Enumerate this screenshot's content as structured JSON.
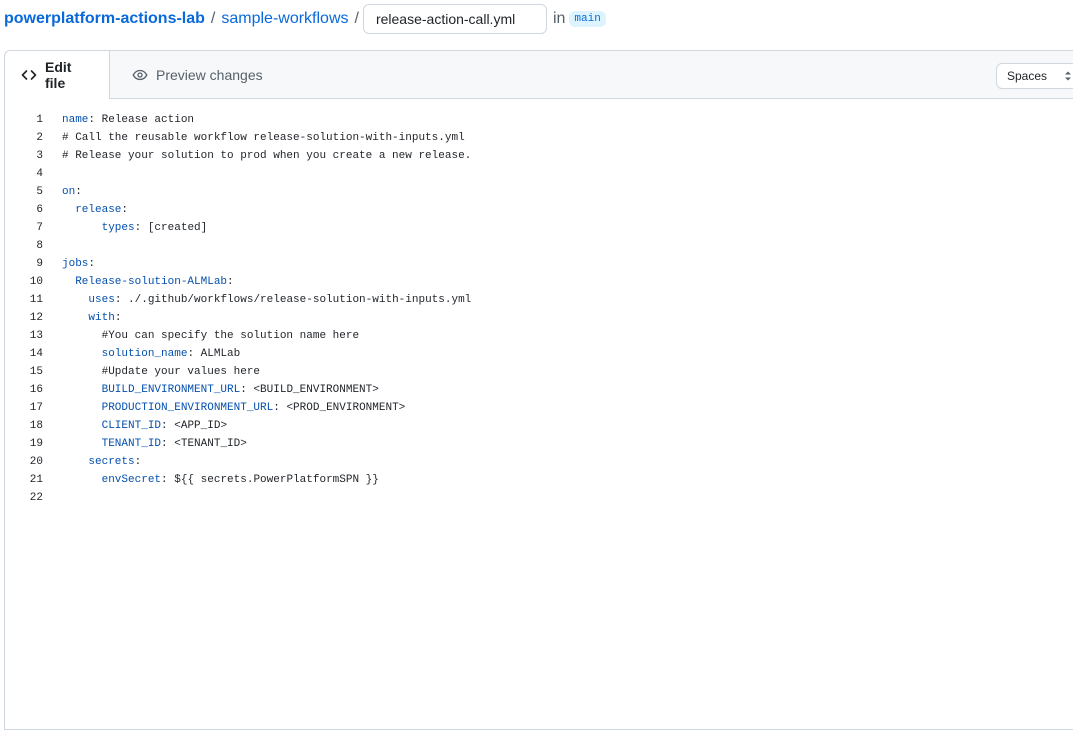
{
  "breadcrumb": {
    "repo": "powerplatform-actions-lab",
    "separator": "/",
    "folder": "sample-workflows",
    "filename_value": "release-action-call.yml",
    "in_label": "in",
    "branch": "main"
  },
  "tabs": {
    "edit": "Edit file",
    "preview": "Preview changes"
  },
  "indent_select": {
    "value": "Spaces"
  },
  "code": {
    "lines": [
      {
        "num": "1",
        "key": "name",
        "rest": " Release action",
        "indent": ""
      },
      {
        "num": "2",
        "text": "# Call the reusable workflow release-solution-with-inputs.yml"
      },
      {
        "num": "3",
        "text": "# Release your solution to prod when you create a new release."
      },
      {
        "num": "4",
        "text": ""
      },
      {
        "num": "5",
        "key": "on",
        "rest": "",
        "indent": ""
      },
      {
        "num": "6",
        "key": "release",
        "rest": "",
        "indent": "  "
      },
      {
        "num": "7",
        "key": "types",
        "rest": " [created]",
        "indent": "      "
      },
      {
        "num": "8",
        "text": ""
      },
      {
        "num": "9",
        "key": "jobs",
        "rest": "",
        "indent": ""
      },
      {
        "num": "10",
        "key": "Release-solution-ALMLab",
        "rest": "",
        "indent": "  "
      },
      {
        "num": "11",
        "key": "uses",
        "rest": " ./.github/workflows/release-solution-with-inputs.yml",
        "indent": "    "
      },
      {
        "num": "12",
        "key": "with",
        "rest": "",
        "indent": "    "
      },
      {
        "num": "13",
        "text": "      #You can specify the solution name here"
      },
      {
        "num": "14",
        "key": "solution_name",
        "rest": " ALMLab",
        "indent": "      "
      },
      {
        "num": "15",
        "text": "      #Update your values here"
      },
      {
        "num": "16",
        "key": "BUILD_ENVIRONMENT_URL",
        "rest": " <BUILD_ENVIRONMENT>",
        "indent": "      "
      },
      {
        "num": "17",
        "key": "PRODUCTION_ENVIRONMENT_URL",
        "rest": " <PROD_ENVIRONMENT>",
        "indent": "      "
      },
      {
        "num": "18",
        "key": "CLIENT_ID",
        "rest": " <APP_ID>",
        "indent": "      "
      },
      {
        "num": "19",
        "key": "TENANT_ID",
        "rest": " <TENANT_ID>",
        "indent": "      "
      },
      {
        "num": "20",
        "key": "secrets",
        "rest": "",
        "indent": "    "
      },
      {
        "num": "21",
        "key": "envSecret",
        "rest": " ${{ secrets.PowerPlatformSPN }}",
        "indent": "      "
      },
      {
        "num": "22",
        "text": ""
      }
    ]
  }
}
